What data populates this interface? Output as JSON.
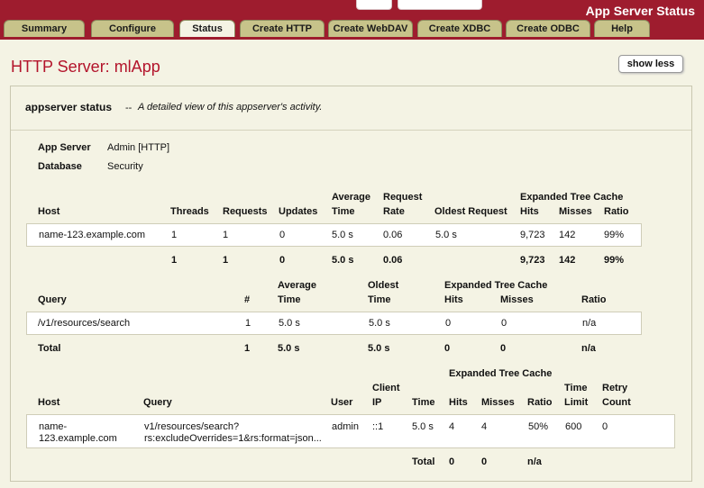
{
  "app": {
    "title": "App Server Status"
  },
  "tabs": [
    {
      "label": "Summary"
    },
    {
      "label": "Configure"
    },
    {
      "label": "Status"
    },
    {
      "label": "Create HTTP"
    },
    {
      "label": "Create WebDAV"
    },
    {
      "label": "Create XDBC"
    },
    {
      "label": "Create ODBC"
    },
    {
      "label": "Help"
    }
  ],
  "header": {
    "title": "HTTP Server: mlApp",
    "show_less": "show less"
  },
  "panel": {
    "title": "appserver status",
    "separator": "--",
    "description": "A detailed view of this appserver's activity."
  },
  "info": {
    "app_server_label": "App Server",
    "app_server_value": "Admin [HTTP]",
    "database_label": "Database",
    "database_value": "Security"
  },
  "hosts_table": {
    "group_header": "Expanded Tree Cache",
    "headers": {
      "host": "Host",
      "threads": "Threads",
      "requests": "Requests",
      "updates": "Updates",
      "avg_top": "Average",
      "avg_bottom": "Time",
      "rate_top": "Request",
      "rate_bottom": "Rate",
      "oldest": "Oldest Request",
      "hits": "Hits",
      "misses": "Misses",
      "ratio": "Ratio"
    },
    "row": {
      "host": "name-123.example.com",
      "threads": "1",
      "requests": "1",
      "updates": "0",
      "avg": "5.0 s",
      "rate": "0.06",
      "oldest": "5.0 s",
      "hits": "9,723",
      "misses": "142",
      "ratio": "99%"
    },
    "total": {
      "threads": "1",
      "requests": "1",
      "updates": "0",
      "avg": "5.0 s",
      "rate": "0.06",
      "hits": "9,723",
      "misses": "142",
      "ratio": "99%"
    }
  },
  "query_table": {
    "group_header": "Expanded Tree Cache",
    "headers": {
      "query": "Query",
      "count": "#",
      "avg_top": "Average",
      "avg_bottom": "Time",
      "oldest_top": "Oldest",
      "oldest_bottom": "Time",
      "hits": "Hits",
      "misses": "Misses",
      "ratio": "Ratio"
    },
    "row": {
      "query": "/v1/resources/search",
      "count": "1",
      "avg": "5.0 s",
      "oldest": "5.0 s",
      "hits": "0",
      "misses": "0",
      "ratio": "n/a"
    },
    "total": {
      "label": "Total",
      "count": "1",
      "avg": "5.0 s",
      "oldest": "5.0 s",
      "hits": "0",
      "misses": "0",
      "ratio": "n/a"
    }
  },
  "request_table": {
    "group_header": "Expanded Tree Cache",
    "headers": {
      "host": "Host",
      "query": "Query",
      "user": "User",
      "client_top": "Client",
      "client_bottom": "IP",
      "time": "Time",
      "hits": "Hits",
      "misses": "Misses",
      "ratio": "Ratio",
      "limit_top": "Time",
      "limit_bottom": "Limit",
      "retry_top": "Retry",
      "retry_bottom": "Count"
    },
    "row": {
      "host_line1": "name-",
      "host_line2": "123.example.com",
      "query_line1": "v1/resources/search?",
      "query_line2": "rs:excludeOverrides=1&rs:format=json...",
      "user": "admin",
      "client": "::1",
      "time": "5.0 s",
      "hits": "4",
      "misses": "4",
      "ratio": "50%",
      "limit": "600",
      "retry": "0"
    },
    "total": {
      "label": "Total",
      "hits": "0",
      "misses": "0",
      "ratio": "n/a"
    }
  }
}
